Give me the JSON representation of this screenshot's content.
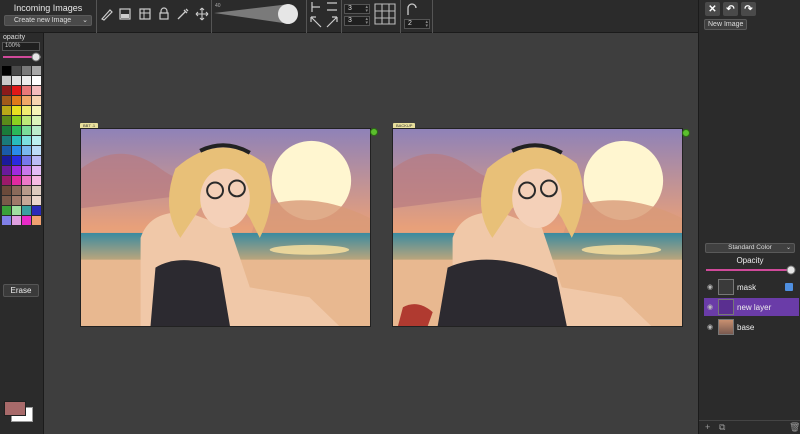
{
  "incoming": {
    "title": "Incoming Images",
    "select_value": "Create new Image"
  },
  "toolbar": {
    "brush_size": "40",
    "grid_cols": "3",
    "grid_rows": "3",
    "curve_value": "2"
  },
  "left_panel": {
    "opacity_label": "opacity",
    "opacity_value": "100%",
    "erase_label": "Erase",
    "palette": [
      "#000000",
      "#4a4a4a",
      "#7a7a7a",
      "#a8a8a8",
      "#c8c8c8",
      "#e0e0e0",
      "#ededed",
      "#ffffff",
      "#8b1a1a",
      "#e01818",
      "#e87878",
      "#f3bcbc",
      "#a05a1a",
      "#e07a1a",
      "#f0a868",
      "#f7d4b0",
      "#b8a818",
      "#e8e020",
      "#f0ec70",
      "#f7f4b8",
      "#5a8a1a",
      "#8ad020",
      "#bce878",
      "#dcf4bc",
      "#1a7a3a",
      "#2ab85a",
      "#7adc9a",
      "#bceccc",
      "#1a7a7a",
      "#28bcbc",
      "#7ce0e0",
      "#bcf0f0",
      "#1a5aa8",
      "#2a8ae8",
      "#7ab8f0",
      "#bcdcf7",
      "#1a1a9a",
      "#2a2ae0",
      "#7878ec",
      "#bcbcf6",
      "#6a1a9a",
      "#a02ae0",
      "#c878ec",
      "#e4bcf6",
      "#9a1a6a",
      "#e02aa0",
      "#ec78c8",
      "#f6bce4",
      "#6a4a3a",
      "#8a6a5a",
      "#b89a8a",
      "#dccabe",
      "#7a5a4a",
      "#a07a6a",
      "#c8a898",
      "#ead6cc",
      "#3aa03a",
      "#a0e0a0",
      "#3aa0a0",
      "#2a2ab8",
      "#8080e8",
      "#e0a0e0",
      "#e82ac8",
      "#f0a070"
    ],
    "fg_color": "#a86a6a",
    "bg_color": "#ffffff"
  },
  "canvas": {
    "left_tag": "BBT .1",
    "right_tag": "BACKUP"
  },
  "right_panel": {
    "new_image_label": "New Image",
    "blend_mode": "Standard Color",
    "opacity_label": "Opacity",
    "layers": [
      {
        "name": "mask"
      },
      {
        "name": "new layer"
      },
      {
        "name": "base"
      }
    ]
  }
}
